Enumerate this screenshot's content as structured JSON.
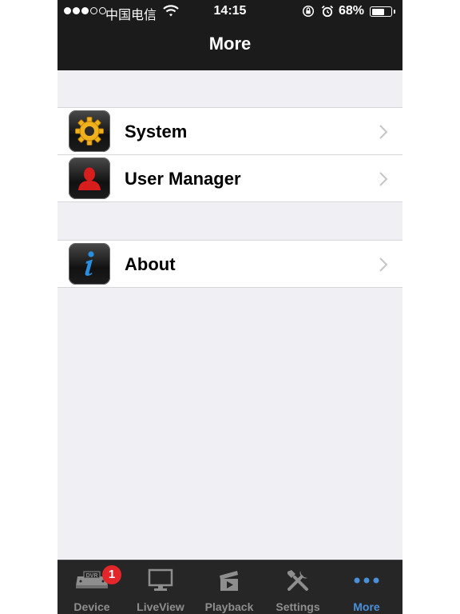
{
  "status_bar": {
    "carrier": "中国电信",
    "time": "14:15",
    "battery_percent": "68%",
    "battery_level": 0.68
  },
  "nav": {
    "title": "More"
  },
  "groups": [
    {
      "items": [
        {
          "label": "System",
          "icon": "gear-icon"
        },
        {
          "label": "User Manager",
          "icon": "user-icon"
        }
      ]
    },
    {
      "items": [
        {
          "label": "About",
          "icon": "info-icon"
        }
      ]
    }
  ],
  "tabbar": {
    "tabs": [
      {
        "label": "Device",
        "icon": "dvr-icon",
        "badge": "1"
      },
      {
        "label": "LiveView",
        "icon": "monitor-icon"
      },
      {
        "label": "Playback",
        "icon": "clapper-icon"
      },
      {
        "label": "Settings",
        "icon": "tools-icon"
      },
      {
        "label": "More",
        "icon": "more-dots-icon",
        "active": true
      }
    ]
  },
  "colors": {
    "nav_background": "#1b1b1b",
    "page_background": "#efeff4",
    "active_tab": "#4a90d9",
    "badge": "#e3262a"
  }
}
